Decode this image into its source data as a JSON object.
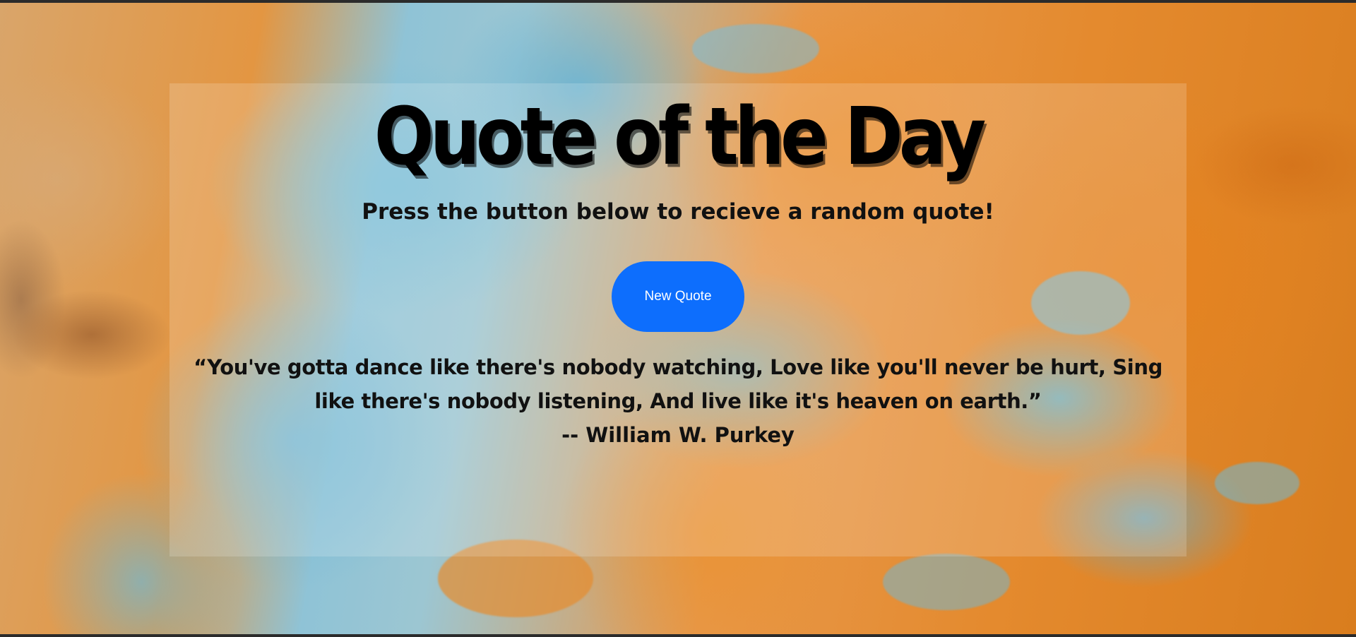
{
  "page": {
    "title": "Quote of the Day",
    "subtitle": "Press the button below to recieve a random quote!"
  },
  "button": {
    "label": "New Quote",
    "color": "#0d6efd"
  },
  "quote": {
    "text": "“You've gotta dance like there's nobody watching, Love like you'll never be hurt, Sing like there's nobody listening, And live like it's heaven on earth.”",
    "author": "-- William W. Purkey"
  }
}
